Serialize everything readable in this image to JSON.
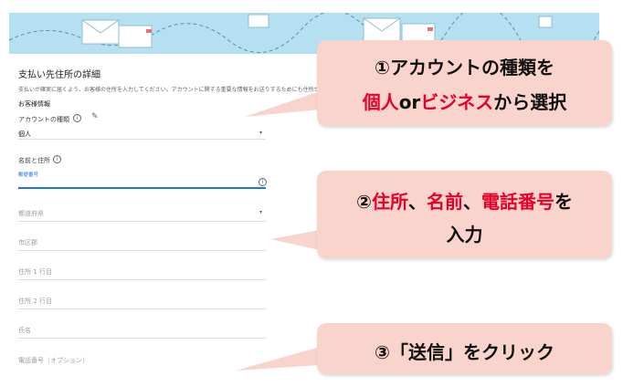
{
  "form": {
    "title": "支払い先住所の詳細",
    "description": "支払いが確実に届くよう、お客様の住所を入力してください。アカウントに関する重要な情報をお送りするためにも住所が必要です",
    "section_label": "お客様情報",
    "account_type_label": "アカウントの種類",
    "account_type_value": "個人",
    "name_address_label": "名前と住所",
    "postal_code_label": "郵便番号",
    "prefecture_placeholder": "都道府県",
    "city_placeholder": "市区郡",
    "address1_placeholder": "住所 1 行目",
    "address2_placeholder": "住所 2 行目",
    "name_placeholder": "氏名",
    "phone_placeholder": "電話番号（オプション）"
  },
  "callouts": {
    "one": {
      "line1": "①アカウントの種類を",
      "personal": "個人",
      "or": "or",
      "business": "ビジネス",
      "tail": "から選択"
    },
    "two": {
      "prefix": "②",
      "address": "住所",
      "sep1": "、",
      "name": "名前",
      "sep2": "、",
      "phone": "電話番号",
      "suffix": "を",
      "line2": "入力"
    },
    "three": {
      "text": "③「送信」をクリック"
    }
  },
  "colors": {
    "banner": "#b4e0f2",
    "callout_bg": "#f8d4cc",
    "accent_red": "#e8002d",
    "focus_blue": "#1a73e8"
  }
}
